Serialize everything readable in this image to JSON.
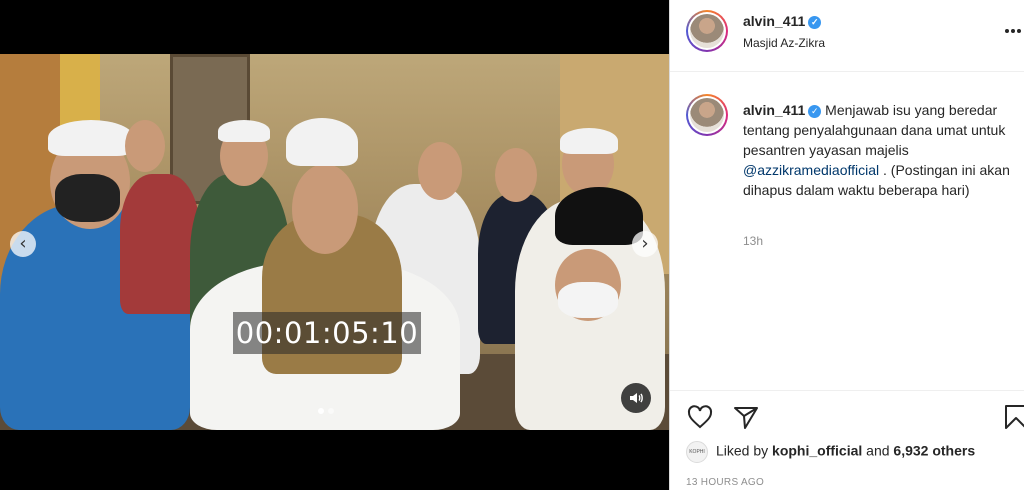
{
  "post": {
    "username": "alvin_411",
    "location": "Masjid Az-Zikra",
    "caption_text": "Menjawab isu yang beredar tentang penyalahgunaan dana umat untuk pesantren yayasan majelis",
    "caption_mention": "@azzikramediaofficial",
    "caption_tail": ". (Postingan ini akan dihapus dalam waktu beberapa hari)",
    "time_ago": "13h",
    "likes_prefix": "Liked by",
    "likes_user": "kophi_official",
    "likes_and": "and",
    "likes_count": "6,932 others",
    "posted_label": "13 HOURS AGO",
    "mini_avatar_text": "KOPHI"
  },
  "media": {
    "timecode": "00:01:05:10",
    "nav_prev_glyph": "‹",
    "nav_next_glyph": "›",
    "carousel_dots": 2,
    "active_dot": 0
  },
  "icons": {
    "verified": "verified-badge-icon",
    "more": "more-options-icon",
    "like": "heart-icon",
    "share": "share-icon",
    "save": "bookmark-icon",
    "sound": "speaker-icon"
  },
  "colors": {
    "accent": "#3897f0",
    "mention": "#00376b",
    "muted": "#8e8e8e",
    "text": "#262626"
  }
}
